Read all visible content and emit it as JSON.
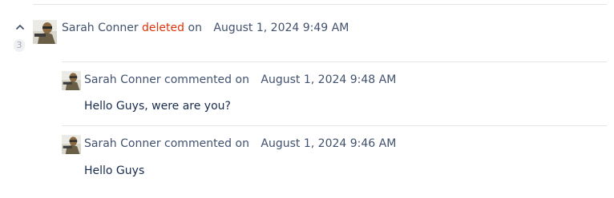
{
  "history": {
    "collapsed_count": "3",
    "entry": {
      "author": "Sarah Conner",
      "action": "deleted",
      "connector": "on",
      "timestamp": "August 1, 2024 9:49 AM"
    },
    "comments": [
      {
        "author": "Sarah Conner",
        "verb": "commented on",
        "timestamp": "August 1, 2024 9:48 AM",
        "body": "Hello Guys, were are you?"
      },
      {
        "author": "Sarah Conner",
        "verb": "commented on",
        "timestamp": "August 1, 2024 9:46 AM",
        "body": "Hello Guys"
      }
    ]
  },
  "colors": {
    "deleted_action": "#de350b",
    "text": "#42526e",
    "divider": "#e2e4e7"
  },
  "icons": {
    "collapse": "chevron-up-icon",
    "avatar": "user-avatar-icon"
  }
}
